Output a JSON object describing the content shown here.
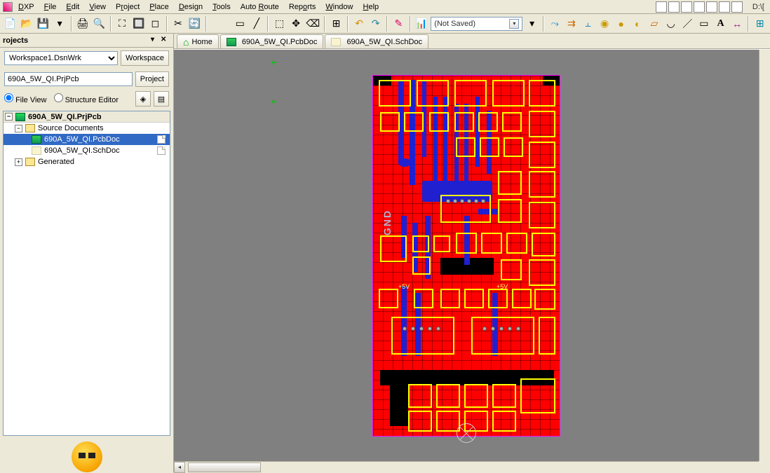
{
  "menu": {
    "items": [
      "DXP",
      "File",
      "Edit",
      "View",
      "Project",
      "Place",
      "Design",
      "Tools",
      "Auto Route",
      "Reports",
      "Window",
      "Help"
    ],
    "path": "D:\\[",
    "underline_idx": [
      0,
      0,
      0,
      0,
      1,
      0,
      0,
      0,
      5,
      3,
      0,
      0
    ]
  },
  "toolbar": {
    "status_label": "(Not Saved)"
  },
  "panel": {
    "title": "rojects",
    "workspace_value": "Workspace1.DsnWrk",
    "workspace_btn": "Workspace",
    "project_value": "690A_5W_QI.PrjPcb",
    "project_btn": "Project",
    "file_view": "File View",
    "structure_editor": "Structure Editor"
  },
  "tree": {
    "root": "690A_5W_QI.PrjPcb",
    "src": "Source Documents",
    "pcb": "690A_5W_QI.PcbDoc",
    "sch": "690A_5W_QI.SchDoc",
    "gen": "Generated"
  },
  "tabs": {
    "home": "Home",
    "pcb": "690A_5W_QI.PcbDoc",
    "sch": "690A_5W_QI.SchDoc"
  },
  "board": {
    "gnd": "GND",
    "p5va": "+5V",
    "p5vb": "+5V"
  }
}
